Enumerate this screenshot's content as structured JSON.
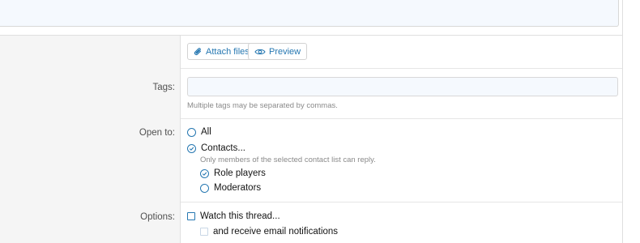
{
  "toolbar": {
    "attach_label": "Attach files",
    "preview_label": "Preview"
  },
  "tags": {
    "label": "Tags:",
    "value": "",
    "hint": "Multiple tags may be separated by commas."
  },
  "open_to": {
    "label": "Open to:",
    "options": [
      {
        "label": "All",
        "selected": false
      },
      {
        "label": "Contacts...",
        "selected": true
      }
    ],
    "contacts_hint": "Only members of the selected contact list can reply.",
    "sub_options": [
      {
        "label": "Role players",
        "selected": true
      },
      {
        "label": "Moderators",
        "selected": false
      }
    ]
  },
  "options": {
    "label": "Options:",
    "watch_label": "Watch this thread...",
    "watch_checked": false,
    "email_label": "and receive email notifications",
    "email_checked": false,
    "email_disabled": true
  },
  "colors": {
    "accent": "#2577b1",
    "label_bg": "#f5f5f5",
    "input_bg": "#f5f9fe"
  }
}
